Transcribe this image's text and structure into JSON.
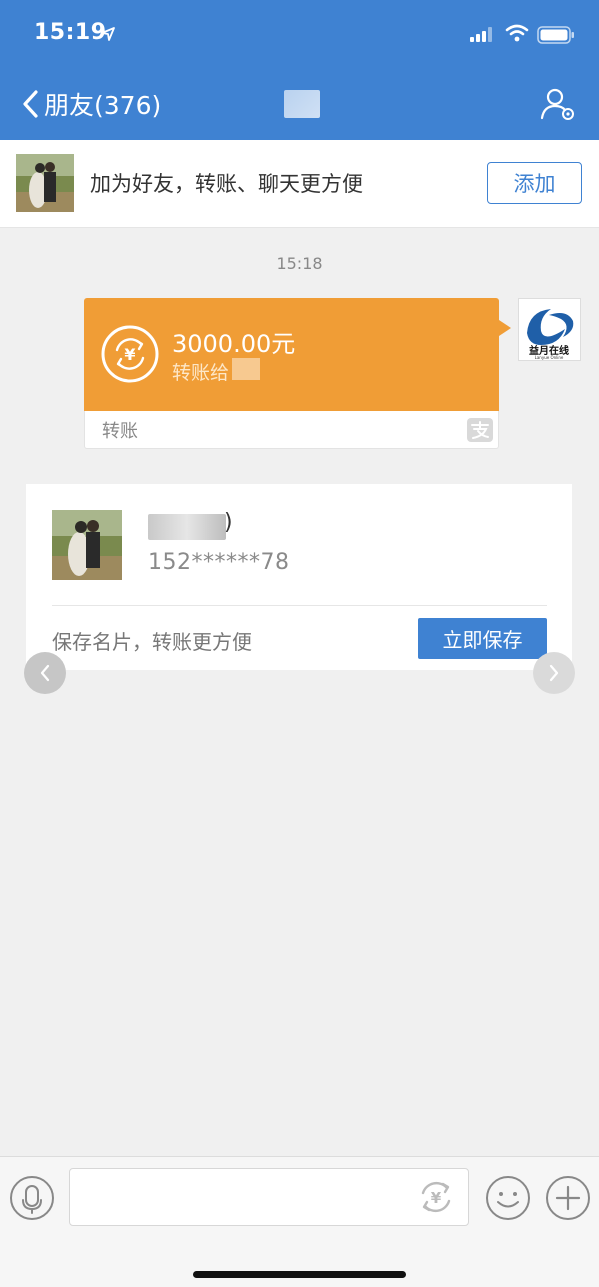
{
  "status_bar": {
    "time": "15:19"
  },
  "nav": {
    "back_label": "朋友(376)"
  },
  "add_friend_bar": {
    "text": "加为好友，转账、聊天更方便",
    "button_label": "添加"
  },
  "chat": {
    "timestamp": "15:18",
    "transfer_message": {
      "amount": "3000.00元",
      "description": "转账给",
      "footer_label": "转账"
    },
    "sender_avatar": {
      "logo_text": "益月在线",
      "logo_subtext": "Lanyue Online"
    }
  },
  "contact_card": {
    "name_suffix": ")",
    "phone": "152******78",
    "tip": "保存名片，转账更方便",
    "save_button_label": "立即保存"
  },
  "input_bar": {
    "placeholder": "",
    "value": ""
  },
  "colors": {
    "header_blue": "#3f82d2",
    "transfer_orange": "#f09d36",
    "background": "#f0f0f0"
  }
}
